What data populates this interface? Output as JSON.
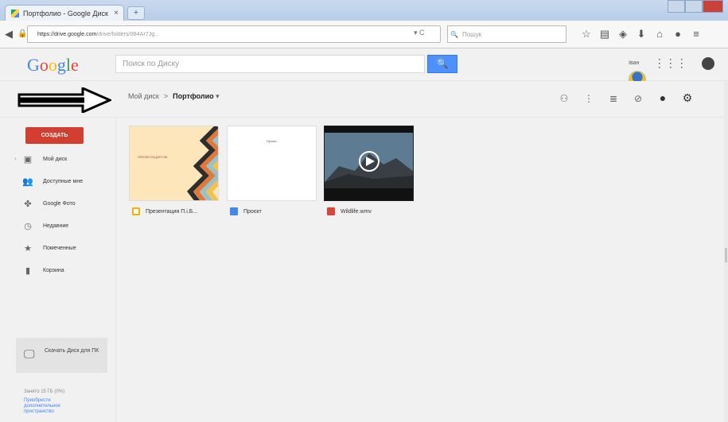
{
  "browser": {
    "tab_title": "Портфолио - Google Диск",
    "tab_close": "×",
    "new_tab": "+",
    "url_prefix": "https://drive.google.com",
    "url_rest": "/drive/folders/0B4Ar7Jg...",
    "search_placeholder": "Пошук"
  },
  "header": {
    "logo": [
      "G",
      "o",
      "o",
      "g",
      "l",
      "e"
    ],
    "search_placeholder": "Поиск по Диску",
    "search_button": "🔍",
    "user_label": "Іван"
  },
  "toolbar": {
    "breadcrumb_root": "Мой диск",
    "breadcrumb_sep": ">",
    "breadcrumb_current": "Портфолио",
    "breadcrumb_caret": "▾"
  },
  "sidebar": {
    "create_label": "СОЗДАТЬ",
    "items": [
      {
        "label": "Мой диск",
        "icon": "drive-icon"
      },
      {
        "label": "Доступные мне",
        "icon": "people-icon"
      },
      {
        "label": "Google Фото",
        "icon": "photos-icon"
      },
      {
        "label": "Недавние",
        "icon": "clock-icon"
      },
      {
        "label": "Помеченные",
        "icon": "star-icon"
      },
      {
        "label": "Корзина",
        "icon": "trash-icon"
      }
    ],
    "download_label": "Скачать Диск для ПК",
    "quota_text": "Занято 15 ГБ (0%)",
    "links_text": "Приобрести дополнительное пространство"
  },
  "files": [
    {
      "name": "Презентация П.і.Б...",
      "type": "slides",
      "color": "#f4b400",
      "thumb_text": "ПРЕЗЕНТАЦИЯ ПІБ"
    },
    {
      "name": "Проєкт",
      "type": "docs",
      "color": "#4285f4",
      "thumb_text": "Проєкт"
    },
    {
      "name": "Wildlife.wmv",
      "type": "video",
      "color": "#db4437",
      "thumb_text": ""
    }
  ],
  "colors": {
    "create_button": "#d23f31",
    "search_button": "#4d90fe",
    "link": "#4285f4"
  }
}
